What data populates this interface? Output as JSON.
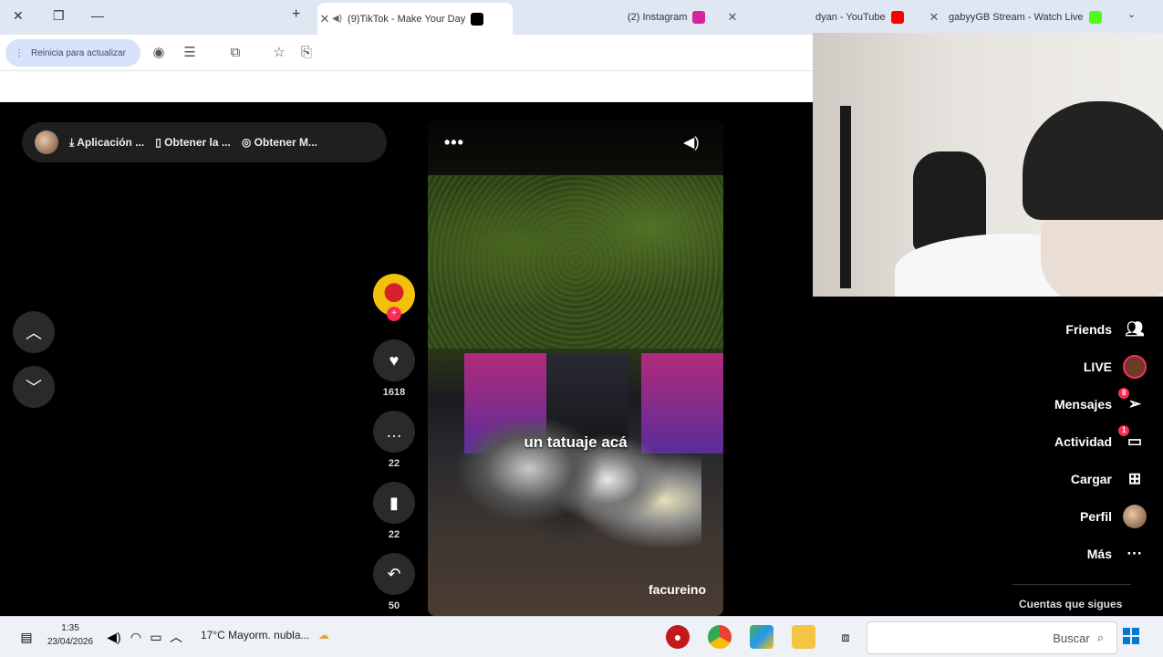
{
  "browser": {
    "tabs": [
      {
        "title": "gabyyGB Stream - Watch Live",
        "favicon_color": "#53fc18"
      },
      {
        "title": "dyan - YouTube",
        "favicon_color": "#ff0000"
      },
      {
        "title": "(2) Instagram",
        "favicon_color": "#d6249f"
      },
      {
        "title": "(9)TikTok - Make Your Day",
        "favicon_color": "#000000"
      }
    ],
    "new_tab_label": "+",
    "update_button_label": "Reinicia para actualizar"
  },
  "topnav": {
    "items": [
      "Obtener M...",
      "Obtener la ...",
      "Aplicación ..."
    ]
  },
  "video": {
    "caption": "un tatuaje acá",
    "author": "facureino",
    "menu": "•••"
  },
  "actions": {
    "likes": "1618",
    "comments": "22",
    "saves": "22",
    "shares": "50"
  },
  "sidebar": {
    "items": [
      {
        "label": "Friends",
        "icon": "friends-icon",
        "badge": ""
      },
      {
        "label": "LIVE",
        "icon": "live-icon",
        "badge": ""
      },
      {
        "label": "Mensajes",
        "icon": "message-icon",
        "badge": "8"
      },
      {
        "label": "Actividad",
        "icon": "activity-icon",
        "badge": "1"
      },
      {
        "label": "Cargar",
        "icon": "upload-icon",
        "badge": ""
      },
      {
        "label": "Perfil",
        "icon": "profile-icon",
        "badge": ""
      },
      {
        "label": "Más",
        "icon": "more-icon",
        "badge": ""
      }
    ],
    "following_header": "Cuentas que sigues"
  },
  "taskbar": {
    "time": "1:35",
    "date": "23/04/2026",
    "weather": "17°C  Mayorm. nubla...",
    "search_placeholder": "Buscar"
  },
  "colors": {
    "accent_pink": "#fe2c55",
    "browser_tab_bg": "#dfe7f3",
    "update_button_bg": "#d7e3fb"
  }
}
